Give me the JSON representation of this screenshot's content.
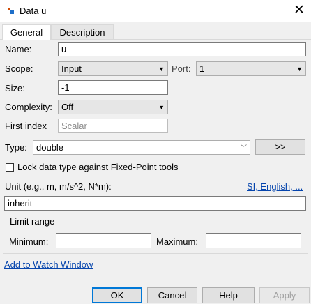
{
  "window": {
    "title": "Data u"
  },
  "tabs": [
    {
      "label": "General"
    },
    {
      "label": "Description"
    }
  ],
  "form": {
    "name_label": "Name:",
    "name_value": "u",
    "scope_label": "Scope:",
    "scope_value": "Input",
    "port_label": "Port:",
    "port_value": "1",
    "size_label": "Size:",
    "size_value": "-1",
    "complexity_label": "Complexity:",
    "complexity_value": "Off",
    "first_index_label": "First index",
    "first_index_placeholder": "Scalar",
    "type_label": "Type:",
    "type_value": "double",
    "type_button": ">>",
    "lock_label": "Lock data type against Fixed-Point tools",
    "unit_label": "Unit (e.g., m, m/s^2, N*m):",
    "unit_link": "SI, English, ...",
    "unit_value": "inherit",
    "limit_range_label": "Limit range",
    "minimum_label": "Minimum:",
    "minimum_value": "",
    "maximum_label": "Maximum:",
    "maximum_value": "",
    "watch_link": "Add to Watch Window"
  },
  "buttons": {
    "ok": "OK",
    "cancel": "Cancel",
    "help": "Help",
    "apply": "Apply"
  }
}
